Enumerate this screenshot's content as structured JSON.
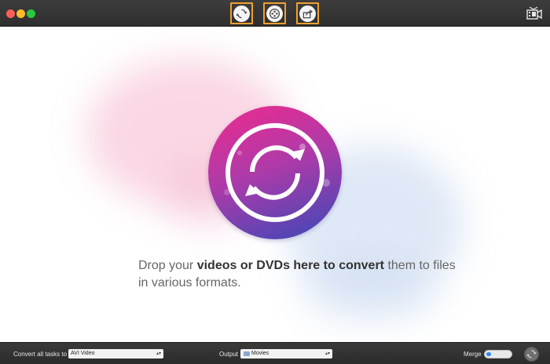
{
  "toolbar": {
    "tools": [
      {
        "number": "1",
        "icon": "convert-icon"
      },
      {
        "number": "2",
        "icon": "burn-icon"
      },
      {
        "number": "3",
        "icon": "share-icon"
      }
    ],
    "top_right_icon": "media-browser-icon"
  },
  "main": {
    "drop_text_part1": "Drop your ",
    "drop_text_bold": "videos or DVDs here to convert",
    "drop_text_part2": " them to files in various formats."
  },
  "bottom": {
    "convert_label": "Convert all tasks to",
    "format_value": "AVI Video",
    "output_label": "Output",
    "output_value": "Movies",
    "merge_label": "Merge",
    "merge_on": true
  },
  "colors": {
    "accent_highlight": "#f0a030",
    "disc_top": "#ee2a8e",
    "disc_bottom": "#3a48b8",
    "toggle_blue": "#2d8bf0"
  }
}
